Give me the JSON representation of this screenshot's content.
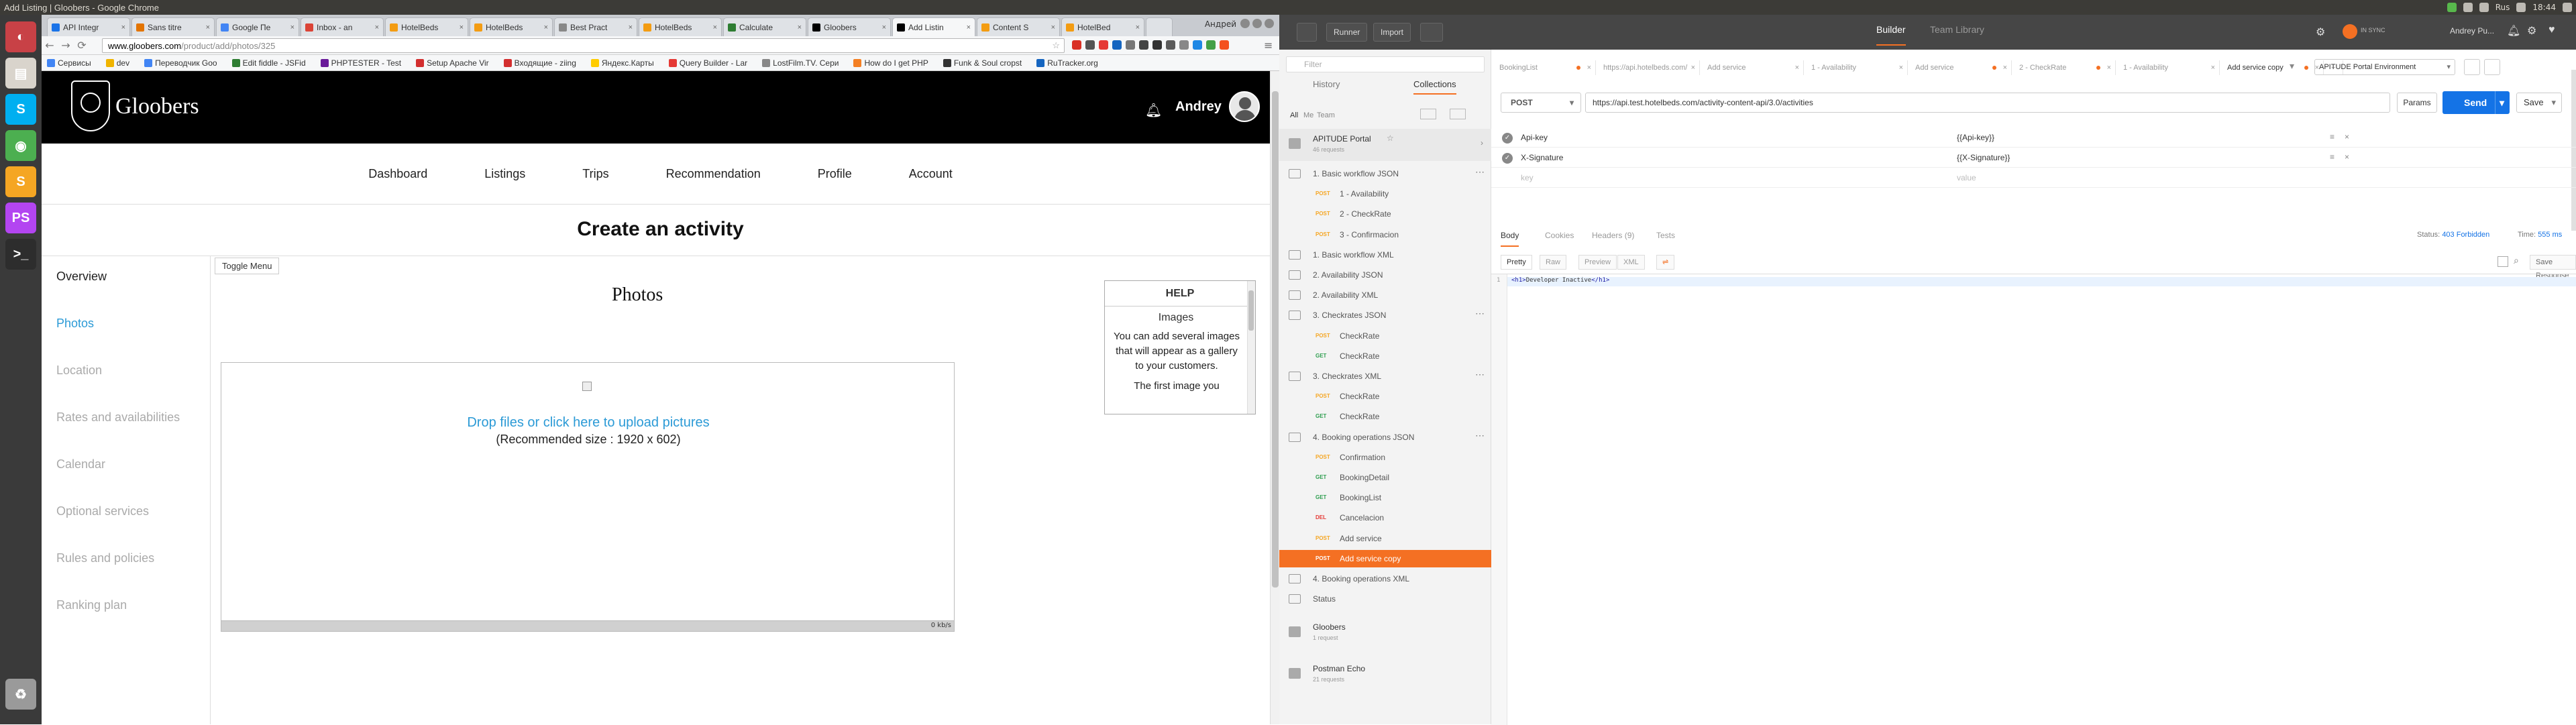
{
  "system": {
    "window_title": "Add Listing | Gloobers - Google Chrome",
    "time": "18:44",
    "lang": "Rus"
  },
  "launcher": [
    {
      "name": "ubuntu-dash-icon",
      "color": "#c84146",
      "glyph": "◐"
    },
    {
      "name": "files-icon",
      "color": "#d9d4cc",
      "glyph": "▤"
    },
    {
      "name": "skype-icon",
      "color": "#00aff0",
      "glyph": "S"
    },
    {
      "name": "chrome-icon",
      "color": "#4caf50",
      "glyph": "◉"
    },
    {
      "name": "sublime-icon",
      "color": "#f5a623",
      "glyph": "S"
    },
    {
      "name": "phpstorm-icon",
      "color": "#b345f1",
      "glyph": "PS"
    },
    {
      "name": "terminal-icon",
      "color": "#2d2d2d",
      "glyph": ">_"
    },
    {
      "name": "trash-icon",
      "color": "#9a9a9a",
      "glyph": "♻"
    }
  ],
  "browser": {
    "tabs": [
      {
        "label": "API Integr",
        "color": "#1a73e8"
      },
      {
        "label": "Sans titre",
        "color": "#e37400"
      },
      {
        "label": "Google Пе",
        "color": "#4285f4"
      },
      {
        "label": "Inbox - an",
        "color": "#db4437"
      },
      {
        "label": "HotelBeds",
        "color": "#f39c12"
      },
      {
        "label": "HotelBeds",
        "color": "#f39c12"
      },
      {
        "label": "Best Pract",
        "color": "#888888"
      },
      {
        "label": "HotelBeds",
        "color": "#f39c12"
      },
      {
        "label": "Calculate",
        "color": "#2e7d32"
      },
      {
        "label": "Gloobers",
        "color": "#000000"
      },
      {
        "label": "Add Listin",
        "color": "#000000"
      },
      {
        "label": "Content S",
        "color": "#f39c12"
      },
      {
        "label": "HotelBed",
        "color": "#f39c12"
      }
    ],
    "active_tab_index": 10,
    "window_user": "Андрей",
    "url_host": "www.gloobers.com",
    "url_path": "/product/add/photos/325",
    "bookmarks": [
      {
        "label": "Сервисы",
        "color": "#4285f4"
      },
      {
        "label": "dev",
        "color": "#f0b400"
      },
      {
        "label": "Переводчик Goo",
        "color": "#4285f4"
      },
      {
        "label": "Edit fiddle - JSFid",
        "color": "#2e7d32"
      },
      {
        "label": "PHPTESTER - Test",
        "color": "#6a1b9a"
      },
      {
        "label": "Setup Apache Vir",
        "color": "#d32f2f"
      },
      {
        "label": "Входящие - ziing",
        "color": "#d32f2f"
      },
      {
        "label": "Яндекс.Карты",
        "color": "#ffcc00"
      },
      {
        "label": "Query Builder - Lar",
        "color": "#e53935"
      },
      {
        "label": "LostFilm.TV. Сери",
        "color": "#888888"
      },
      {
        "label": "How do I get PHP",
        "color": "#f48024"
      },
      {
        "label": "Funk & Soul cropst",
        "color": "#333333"
      },
      {
        "label": "RuTracker.org",
        "color": "#1565c0"
      }
    ]
  },
  "site": {
    "logo_text": "Gloobers",
    "user_name": "Andrey",
    "nav": [
      "Dashboard",
      "Listings",
      "Trips",
      "Recommendation",
      "Profile",
      "Account"
    ],
    "page_title": "Create an activity",
    "sidebar": [
      "Overview",
      "Photos",
      "Location",
      "Rates and availabilities",
      "Calendar",
      "Optional services",
      "Rules and policies",
      "Ranking plan"
    ],
    "active_sidebar_index": 1,
    "toggle_menu": "Toggle Menu",
    "section_title": "Photos",
    "dropzone": {
      "link": "Drop files or click here to upload pictures",
      "size_note": "(Recommended size : 1920 x 602)",
      "rate": "0 kb/s"
    },
    "help": {
      "title": "HELP",
      "subtitle": "Images",
      "body": "You can add several images that will appear as a gallery to your customers.",
      "more": "The first image you"
    }
  },
  "postman": {
    "runner": "Runner",
    "import": "Import",
    "builder": "Builder",
    "team_library": "Team Library",
    "sync": "IN SYNC",
    "user": "Andrey Pu...",
    "filter_placeholder": "Filter",
    "subtabs": [
      "History",
      "Collections"
    ],
    "filters": [
      "All",
      "Me",
      "Team"
    ],
    "collection": {
      "name": "APITUDE Portal",
      "count": "46 requests"
    },
    "items": [
      {
        "type": "folder",
        "label": "1. Basic workflow JSON"
      },
      {
        "type": "req",
        "method": "POST",
        "mcolor": "#f5a623",
        "label": "1 - Availability"
      },
      {
        "type": "req",
        "method": "POST",
        "mcolor": "#f5a623",
        "label": "2 - CheckRate"
      },
      {
        "type": "req",
        "method": "POST",
        "mcolor": "#f5a623",
        "label": "3 - Confirmacion"
      },
      {
        "type": "folder",
        "label": "1. Basic workflow XML"
      },
      {
        "type": "folder",
        "label": "2. Availability JSON"
      },
      {
        "type": "folder",
        "label": "2. Availability XML"
      },
      {
        "type": "folder",
        "label": "3. Checkrates JSON"
      },
      {
        "type": "req",
        "method": "POST",
        "mcolor": "#f5a623",
        "label": "CheckRate"
      },
      {
        "type": "req",
        "method": "GET",
        "mcolor": "#2e9e4f",
        "label": "CheckRate"
      },
      {
        "type": "folder",
        "label": "3. Checkrates XML"
      },
      {
        "type": "req",
        "method": "POST",
        "mcolor": "#f5a623",
        "label": "CheckRate"
      },
      {
        "type": "req",
        "method": "GET",
        "mcolor": "#2e9e4f",
        "label": "CheckRate"
      },
      {
        "type": "folder",
        "label": "4. Booking operations JSON"
      },
      {
        "type": "req",
        "method": "POST",
        "mcolor": "#f5a623",
        "label": "Confirmation"
      },
      {
        "type": "req",
        "method": "GET",
        "mcolor": "#2e9e4f",
        "label": "BookingDetail"
      },
      {
        "type": "req",
        "method": "GET",
        "mcolor": "#2e9e4f",
        "label": "BookingList"
      },
      {
        "type": "req",
        "method": "DEL",
        "mcolor": "#e53935",
        "label": "Cancelacion"
      },
      {
        "type": "req",
        "method": "POST",
        "mcolor": "#f5a623",
        "label": "Add service"
      },
      {
        "type": "req",
        "method": "POST",
        "mcolor": "#ffffff",
        "label": "Add service copy",
        "active": true
      },
      {
        "type": "folder",
        "label": "4. Booking operations XML"
      },
      {
        "type": "folder",
        "label": "Status"
      }
    ],
    "collections2": [
      {
        "name": "Gloobers",
        "count": "1 request"
      },
      {
        "name": "Postman Echo",
        "count": "21 requests"
      }
    ],
    "request_tabs": [
      "BookingList",
      "https://api.hotelbeds.com/",
      "Add service",
      "1 - Availability",
      "Add service",
      "2 - CheckRate",
      "1 - Availability",
      "Add service copy"
    ],
    "environment": "APITUDE Portal Environment",
    "method": "POST",
    "url": "https://api.test.hotelbeds.com/activity-content-api/3.0/activities",
    "params": "Params",
    "send": "Send",
    "save": "Save",
    "headers": [
      {
        "key": "Api-key",
        "value": "{{Api-key}}"
      },
      {
        "key": "X-Signature",
        "value": "{{X-Signature}}"
      }
    ],
    "header_placeholder": {
      "key": "key",
      "value": "value"
    },
    "response_tabs": [
      "Body",
      "Cookies",
      "Headers (9)",
      "Tests"
    ],
    "status_label": "Status:",
    "status_value": "403 Forbidden",
    "time_label": "Time:",
    "time_value": "555 ms",
    "formats": [
      "Pretty",
      "Raw",
      "Preview",
      "XML"
    ],
    "save_response": "Save Response",
    "code_line_number": "1",
    "code_open": "<h1>",
    "code_text": "Developer Inactive",
    "code_close": "</h1>"
  }
}
